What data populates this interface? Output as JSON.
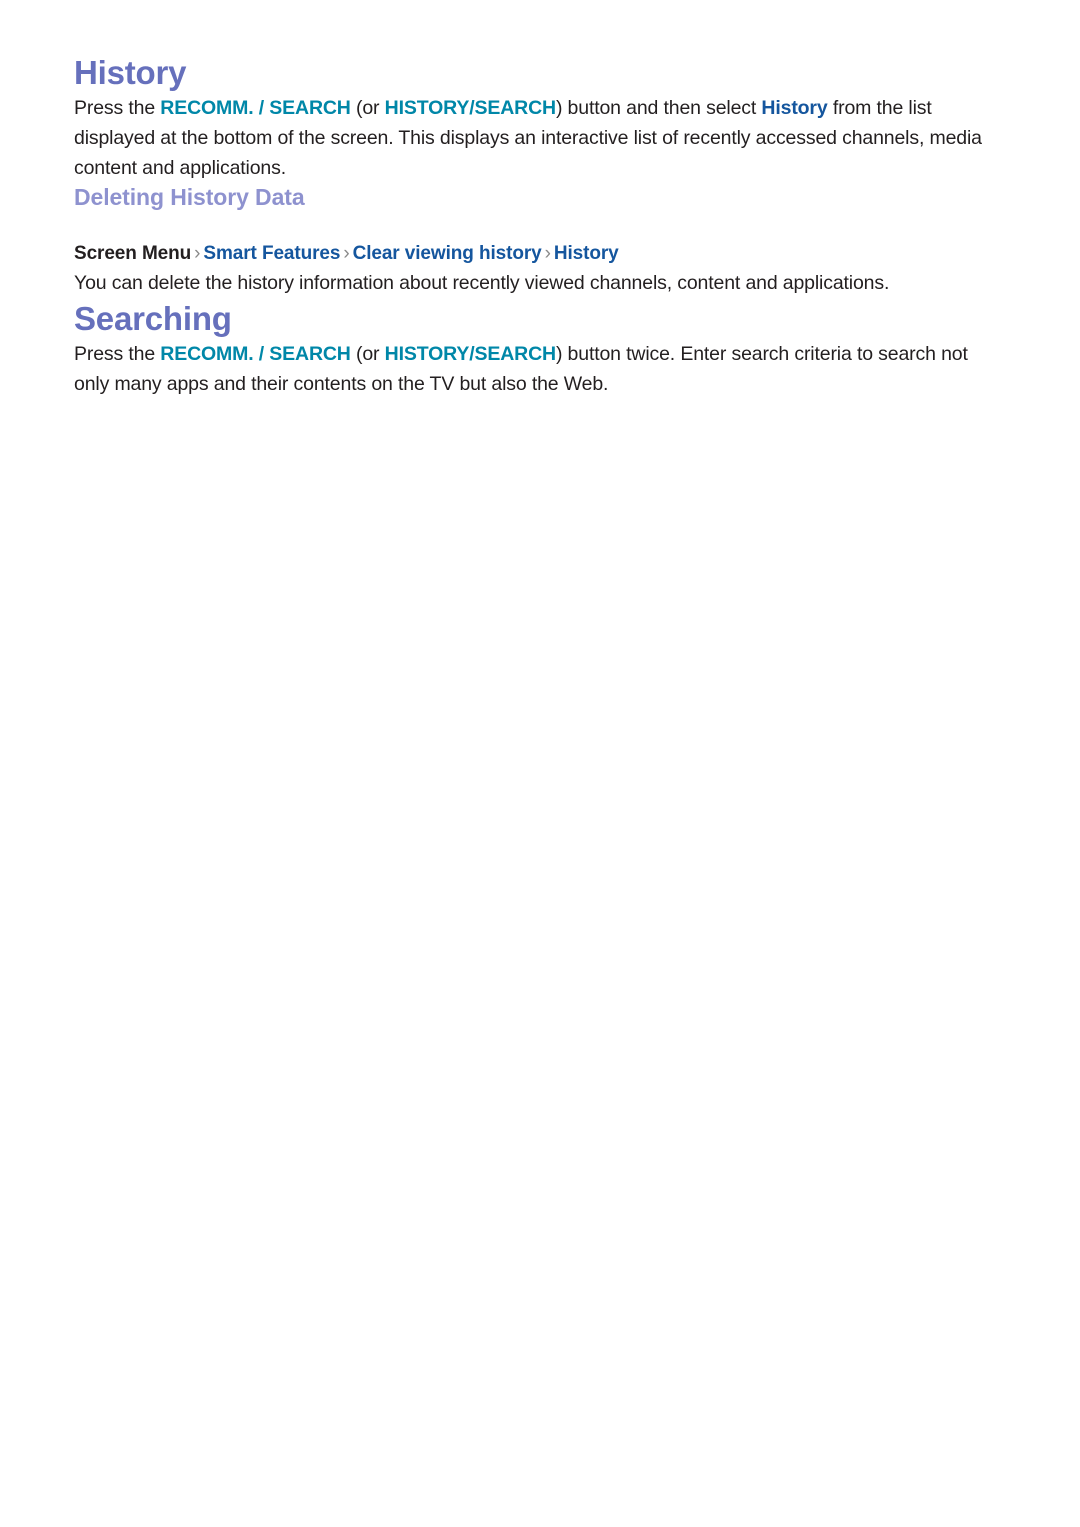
{
  "document": {
    "sections": [
      {
        "id": "history",
        "heading": "History",
        "paragraph_parts": {
          "p1_a": "Press the ",
          "p1_btn1": "RECOMM. / SEARCH",
          "p1_b": " (or ",
          "p1_btn2": "HISTORY/SEARCH",
          "p1_c": ") button and then select ",
          "p1_link": "History",
          "p1_d": " from the list displayed at the bottom of the screen. This displays an interactive list of recently accessed channels, media content and applications."
        }
      },
      {
        "id": "deleting-history-data",
        "heading": "Deleting History Data",
        "breadcrumb": {
          "root": "Screen Menu",
          "separator": "›",
          "items": [
            "Smart Features",
            "Clear viewing history",
            "History"
          ]
        },
        "paragraph": "You can delete the history information about recently viewed channels, content and applications."
      },
      {
        "id": "searching",
        "heading": "Searching",
        "paragraph_parts": {
          "p3_a": "Press the ",
          "p3_btn1": "RECOMM. / SEARCH",
          "p3_b": " (or ",
          "p3_btn2": "HISTORY/SEARCH",
          "p3_c": ") button twice. Enter search criteria to search not only many apps and their contents on the TV but also the Web."
        }
      }
    ],
    "colors": {
      "heading_primary": "#6670bc",
      "heading_secondary": "#8e92cf",
      "button_name": "#0087a8",
      "menu_link": "#15569e",
      "body_text": "#231f20",
      "breadcrumb_separator": "#8a8a8a",
      "background": "#ffffff"
    }
  }
}
